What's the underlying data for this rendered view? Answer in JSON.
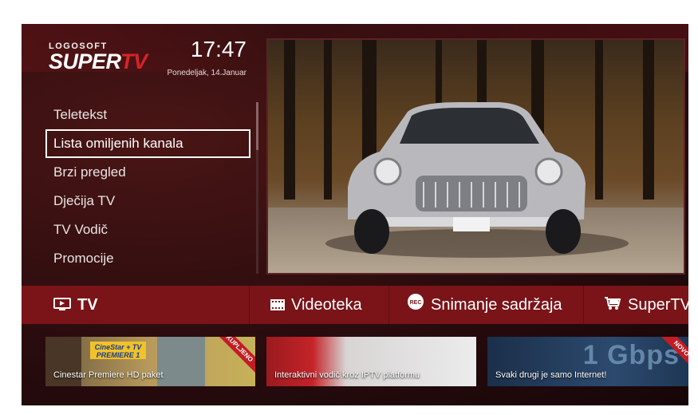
{
  "branding": {
    "logo_top": "LOGOSOFT",
    "logo_super": "SUPER",
    "logo_tv": "TV"
  },
  "clock": {
    "time": "17:47",
    "date": "Ponedeljak, 14.Januar"
  },
  "menu": {
    "items": [
      {
        "label": "Teletekst",
        "selected": false
      },
      {
        "label": "Lista omiljenih kanala",
        "selected": true
      },
      {
        "label": "Brzi pregled",
        "selected": false
      },
      {
        "label": "Dječija TV",
        "selected": false
      },
      {
        "label": "TV Vodič",
        "selected": false
      },
      {
        "label": "Promocije",
        "selected": false
      }
    ]
  },
  "nav": {
    "items": [
      {
        "label": "TV",
        "icon": "tv-icon",
        "active": true
      },
      {
        "label": "Videoteka",
        "icon": "film-icon",
        "active": false
      },
      {
        "label": "Snimanje sadržaja",
        "icon": "rec-icon",
        "active": false
      },
      {
        "label": "SuperTV",
        "icon": "cart-icon",
        "active": false
      }
    ]
  },
  "cards": [
    {
      "label": "Cinestar Premiere HD paket",
      "badge": "CineStar + TV PREMIERE 1",
      "ribbon": "KUPLJENO"
    },
    {
      "label": "Interaktivni vodič kroz IPTV platformu"
    },
    {
      "label": "Svaki drugi je samo Internet!",
      "overlay": "1 Gbps",
      "ribbon": "NOVO"
    }
  ],
  "colors": {
    "accent": "#d8232a",
    "navbar": "#7a1418",
    "background": "#2a0c0e"
  }
}
